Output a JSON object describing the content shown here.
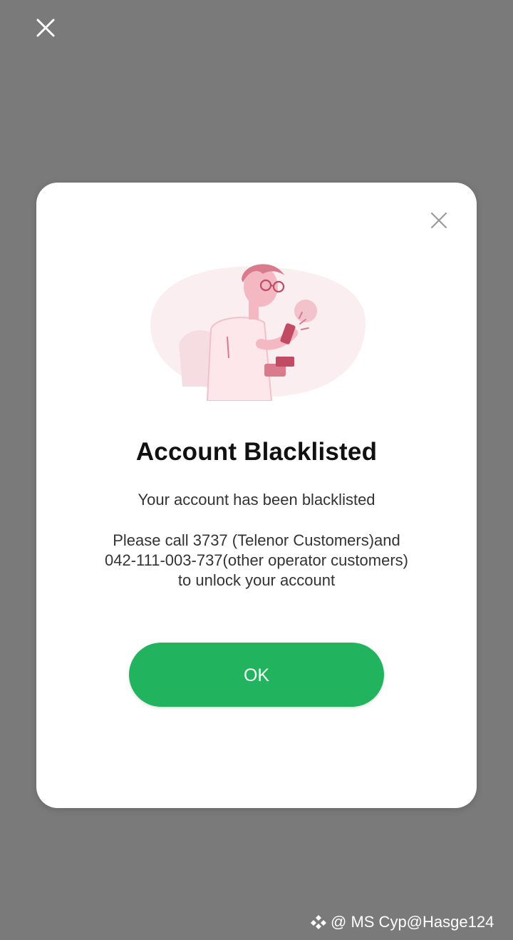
{
  "screen": {
    "overlay_color": "#7a7a7a",
    "close_icon": "close-icon"
  },
  "dialog": {
    "close_icon": "close-icon",
    "illustration": "man-looking-at-phone-illustration",
    "title": "Account Blacklisted",
    "subtitle": "Your account has been blacklisted",
    "instructions": [
      "Please call 3737 (Telenor Customers)and",
      "042-111-003-737(other operator customers)",
      "to unlock your account"
    ],
    "ok_label": "OK",
    "accent_color": "#22b35e"
  },
  "watermark": {
    "icon": "diamond-logo-icon",
    "text": "@ MS Cyp@Hasge124"
  }
}
